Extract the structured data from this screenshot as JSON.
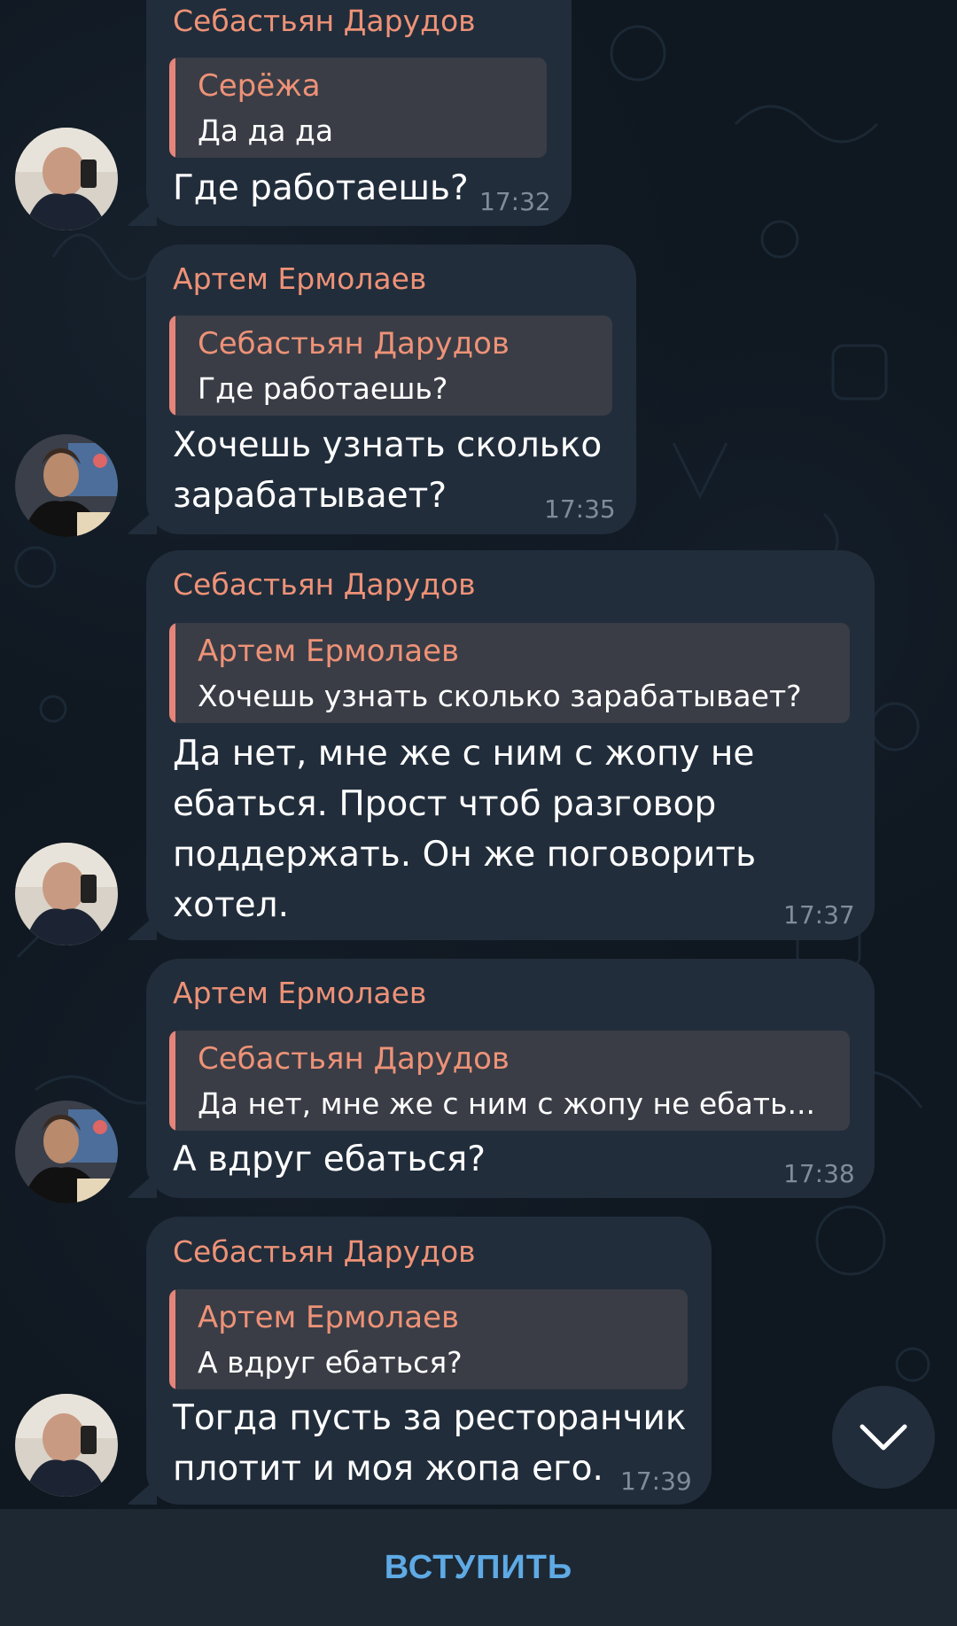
{
  "messages": [
    {
      "sender": "Себастьян Дарудов",
      "reply": {
        "name": "Серёжа",
        "text": "Да да да"
      },
      "lines": [
        "Где работаешь?"
      ],
      "time": "17:32"
    },
    {
      "sender": "Артем Ермолаев",
      "reply": {
        "name": "Себастьян Дарудов",
        "text": "Где работаешь?"
      },
      "lines": [
        "Хочешь узнать сколько",
        "зарабатывает?"
      ],
      "time": "17:35"
    },
    {
      "sender": "Себастьян Дарудов",
      "reply": {
        "name": "Артем Ермолаев",
        "text": "Хочешь узнать сколько зарабатывает?"
      },
      "lines": [
        "Да нет,  мне же с ним с жопу не",
        "ебаться.  Прост чтоб разговор",
        "поддержать. Он же поговорить",
        "хотел."
      ],
      "time": "17:37"
    },
    {
      "sender": "Артем Ермолаев",
      "reply": {
        "name": "Себастьян Дарудов",
        "text": "Да нет,  мне же с ним с жопу не ебать..."
      },
      "lines": [
        "А вдруг ебаться?"
      ],
      "time": "17:38"
    },
    {
      "sender": "Себастьян Дарудов",
      "reply": {
        "name": "Артем Ермолаев",
        "text": "А вдруг ебаться?"
      },
      "lines": [
        "Тогда пусть за ресторанчик",
        "плотит и моя жопа его."
      ],
      "time": "17:39"
    }
  ],
  "join_button": "ВСТУПИТЬ",
  "icons": {
    "scroll_down": "chevron-down-icon",
    "avatar_sebastian": "avatar",
    "avatar_artem": "avatar"
  },
  "colors": {
    "background": "#0f1720",
    "bubble": "#212d3b",
    "accent_name": "#ee9277",
    "join": "#5eaae5"
  }
}
